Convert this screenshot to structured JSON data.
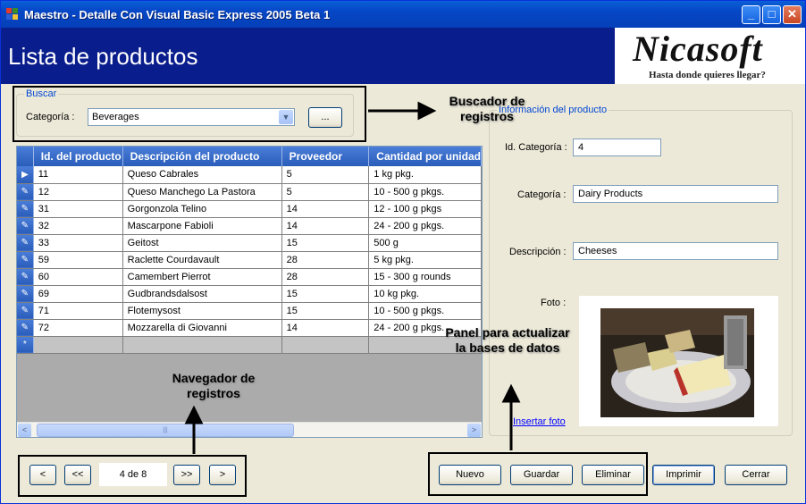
{
  "window": {
    "title": "Maestro - Detalle Con Visual Basic Express 2005 Beta 1",
    "min_glyph": "_",
    "max_glyph": "□",
    "close_glyph": "✕"
  },
  "header": {
    "title": "Lista de productos"
  },
  "logo": {
    "name": "Nicasoft",
    "tagline": "Hasta donde quieres llegar?"
  },
  "search": {
    "group_label": "Buscar",
    "category_label": "Categoría :",
    "category_value": "Beverages",
    "browse_label": "..."
  },
  "grid": {
    "columns": [
      "Id. del producto",
      "Descripción del producto",
      "Proveedor",
      "Cantidad por unidad"
    ],
    "rows": [
      {
        "id": "11",
        "desc": "Queso Cabrales",
        "prov": "5",
        "qty": "1 kg pkg."
      },
      {
        "id": "12",
        "desc": "Queso Manchego La Pastora",
        "prov": "5",
        "qty": "10 - 500 g pkgs."
      },
      {
        "id": "31",
        "desc": "Gorgonzola Telino",
        "prov": "14",
        "qty": "12 - 100 g pkgs"
      },
      {
        "id": "32",
        "desc": "Mascarpone Fabioli",
        "prov": "14",
        "qty": "24 - 200 g pkgs."
      },
      {
        "id": "33",
        "desc": "Geitost",
        "prov": "15",
        "qty": "500 g"
      },
      {
        "id": "59",
        "desc": "Raclette Courdavault",
        "prov": "28",
        "qty": "5 kg pkg."
      },
      {
        "id": "60",
        "desc": "Camembert Pierrot",
        "prov": "28",
        "qty": "15 - 300 g rounds"
      },
      {
        "id": "69",
        "desc": "Gudbrandsdalsost",
        "prov": "15",
        "qty": "10 kg pkg."
      },
      {
        "id": "71",
        "desc": "Flotemysost",
        "prov": "15",
        "qty": "10 - 500 g pkgs."
      },
      {
        "id": "72",
        "desc": "Mozzarella di Giovanni",
        "prov": "14",
        "qty": "24 - 200 g pkgs."
      }
    ],
    "current_row_marker": "▶",
    "edit_marker": "✎",
    "new_row_marker": "*",
    "scroll_left_glyph": "<",
    "scroll_right_glyph": ">",
    "scroll_thumb_grip": "|||"
  },
  "product_info": {
    "group_label": "Información del producto",
    "id_label": "Id. Categoría :",
    "id_value": "4",
    "category_label": "Categoría :",
    "category_value": "Dairy Products",
    "description_label": "Descripción :",
    "description_value": "Cheeses",
    "photo_label": "Foto :",
    "insert_photo_link": "Insertar foto"
  },
  "navigator": {
    "prev_label": "<",
    "first_label": "<<",
    "position": "4 de  8",
    "next_label": ">>",
    "last_label": ">"
  },
  "actions": {
    "new_label": "Nuevo",
    "save_label": "Guardar",
    "delete_label": "Eliminar",
    "print_label": "Imprimir",
    "close_label": "Cerrar"
  },
  "annotations": {
    "search": "Buscador de registros",
    "navigator": "Navegador de registros",
    "panel": "Panel para actualizar la bases de datos"
  },
  "colors": {
    "header_bg": "#0a1d8c",
    "titlebar": "#0646c6",
    "form_bg": "#ece9d8",
    "grid_header": "#2a5cba"
  }
}
